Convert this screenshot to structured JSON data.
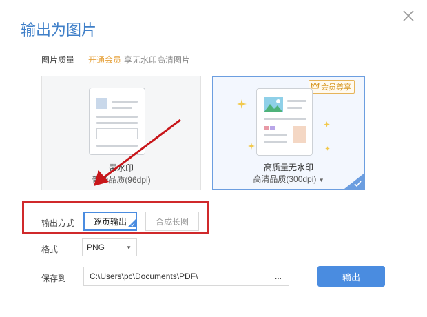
{
  "dialog": {
    "title": "输出为图片"
  },
  "quality": {
    "label": "图片质量",
    "vip_link": "开通会员",
    "vip_desc": "享无水印高清图片",
    "option1": {
      "title": "带水印",
      "subtitle": "普通品质(96dpi)"
    },
    "option2": {
      "title": "高质量无水印",
      "subtitle": "高清品质(300dpi)",
      "badge": "会员尊享",
      "selected": true
    }
  },
  "output_mode": {
    "label": "输出方式",
    "options": [
      "逐页输出",
      "合成长图"
    ],
    "selected": "逐页输出"
  },
  "format": {
    "label": "格式",
    "value": "PNG"
  },
  "save_to": {
    "label": "保存到",
    "path": "C:\\Users\\pc\\Documents\\PDF\\",
    "browse": "..."
  },
  "export_button": "输出",
  "colors": {
    "accent": "#4a8ce0",
    "title": "#3f7fc8",
    "vip": "#e6a23c",
    "annotation": "#d0292b"
  }
}
